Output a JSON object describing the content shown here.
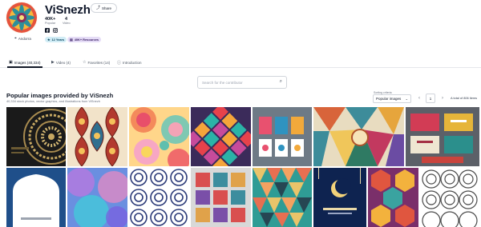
{
  "profile": {
    "name": "ViSnezh",
    "share_label": "Share",
    "stats": [
      {
        "value": "40K+",
        "label": "Popular"
      },
      {
        "value": "4",
        "label": "Video"
      }
    ],
    "location": "Andorra",
    "badges": [
      {
        "icon": "crown-icon",
        "label": "12 Years"
      },
      {
        "icon": "file-icon",
        "label": "40K+ Resources"
      }
    ],
    "social": [
      "facebook-icon",
      "instagram-icon"
    ]
  },
  "tabs": [
    {
      "icon": "image-icon",
      "label": "Images (40,334)",
      "active": true
    },
    {
      "icon": "video-icon",
      "label": "Video (4)",
      "active": false
    },
    {
      "icon": "star-icon",
      "label": "Favorites (14)",
      "active": false
    },
    {
      "icon": "info-icon",
      "label": "Introduction",
      "active": false
    }
  ],
  "search": {
    "placeholder": "Search for the contributor",
    "value": ""
  },
  "section": {
    "title": "Popular images provided by ViSnezh",
    "subtitle": "40,334 stock photos, vector graphics, and illustrations from ViSnezh"
  },
  "sort": {
    "label": "Sorting criteria",
    "selected": "Popular images"
  },
  "pagination": {
    "current": "1",
    "total_label": "A total of 806 items"
  },
  "colors": {
    "accent": "#111827",
    "badge_years": "#d1ecf5",
    "badge_resources": "#e5dcf6"
  }
}
